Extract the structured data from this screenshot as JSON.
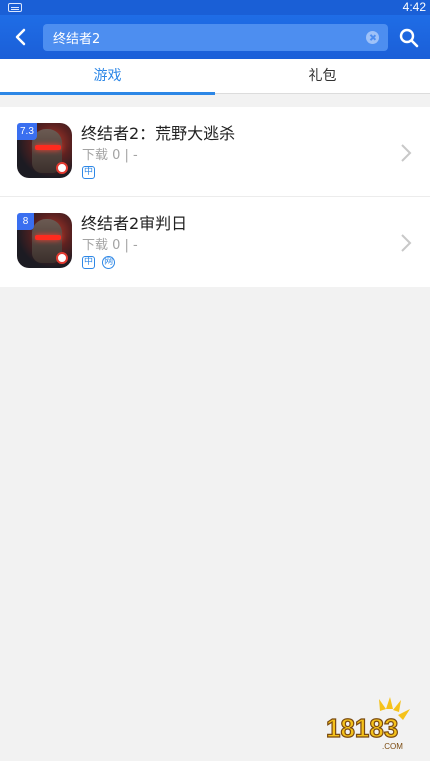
{
  "status_bar": {
    "time": "4:42"
  },
  "search": {
    "query": "终结者2"
  },
  "tabs": [
    {
      "label": "游戏",
      "active": true
    },
    {
      "label": "礼包",
      "active": false
    }
  ],
  "results": [
    {
      "rating": "7.3",
      "title": "终结者2：荒野大逃杀",
      "meta": "下载 0 | -",
      "tags": [
        "中"
      ]
    },
    {
      "rating": "8",
      "title": "终结者2审判日",
      "meta": "下载 0 | -",
      "tags": [
        "中",
        "网"
      ]
    }
  ],
  "watermark": {
    "text": "18183",
    "sub": ".COM"
  },
  "colors": {
    "toolbar": "#1b5fd8",
    "accent": "#2d87e6",
    "rating_badge": "#3a6ff0"
  }
}
